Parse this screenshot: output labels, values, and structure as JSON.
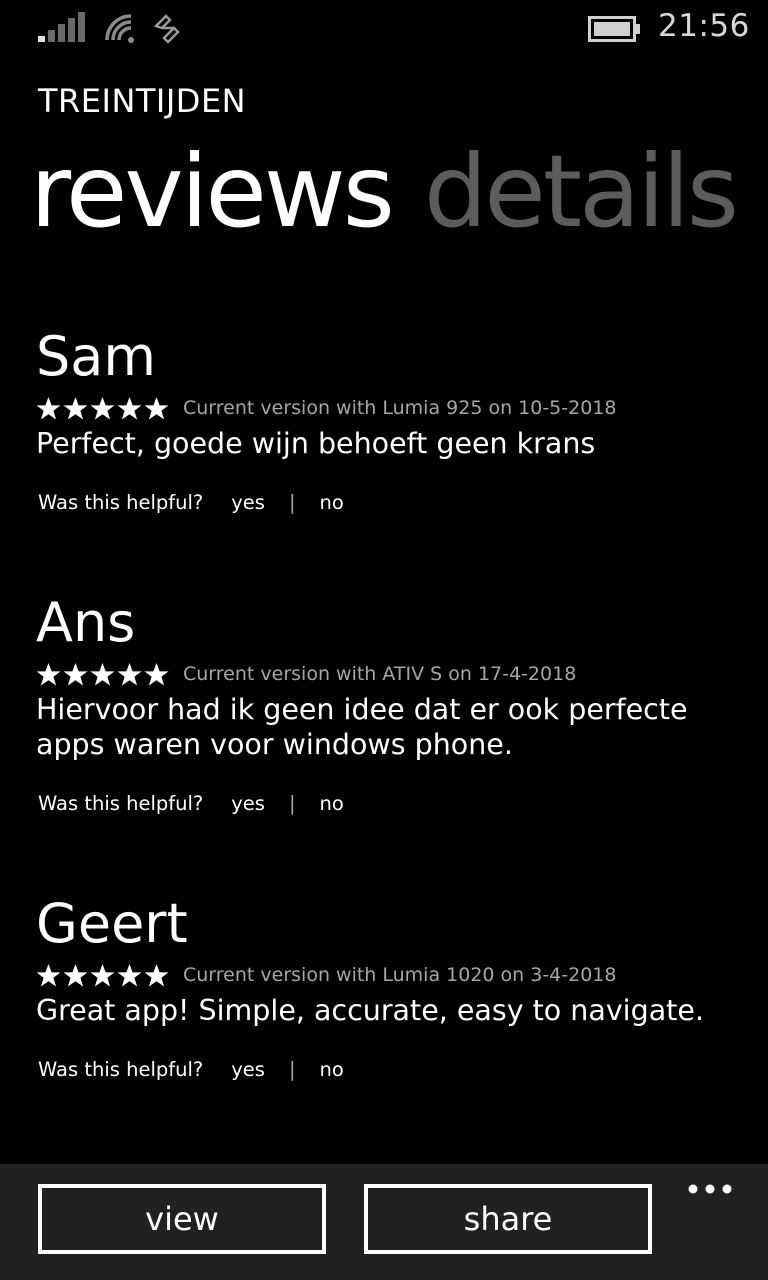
{
  "status_bar": {
    "time": "21:56",
    "icons": [
      "signal-icon",
      "wifi-icon",
      "data-icon",
      "battery-icon"
    ]
  },
  "app": {
    "title": "TREINTIJDEN"
  },
  "pivot": {
    "active": "reviews",
    "inactive": "details"
  },
  "reviews": [
    {
      "author": "Sam",
      "rating": 5,
      "meta": "Current version with Lumia 925 on 10-5-2018",
      "body": "Perfect, goede wijn behoeft geen krans",
      "helpful_label": "Was this helpful?",
      "yes": "yes",
      "separator": "|",
      "no": "no"
    },
    {
      "author": "Ans",
      "rating": 5,
      "meta": "Current version with ATIV S on 17-4-2018",
      "body_line1": "Hiervoor had ik geen idee dat er ook perfecte",
      "body_line2": "apps waren voor windows phone.",
      "helpful_label": "Was this helpful?",
      "yes": "yes",
      "separator": "|",
      "no": "no"
    },
    {
      "author": "Geert",
      "rating": 5,
      "meta": "Current version with Lumia 1020 on 3-4-2018",
      "body": "Great app! Simple, accurate, easy to navigate.",
      "helpful_label": "Was this helpful?",
      "yes": "yes",
      "separator": "|",
      "no": "no"
    }
  ],
  "app_bar": {
    "view_label": "view",
    "share_label": "share",
    "more_icon": "more-icon"
  },
  "colors": {
    "background": "#000000",
    "text": "#ffffff",
    "meta_text": "#a6a6a6",
    "inactive_pivot": "#5c5c5c",
    "app_bar": "#212121"
  }
}
